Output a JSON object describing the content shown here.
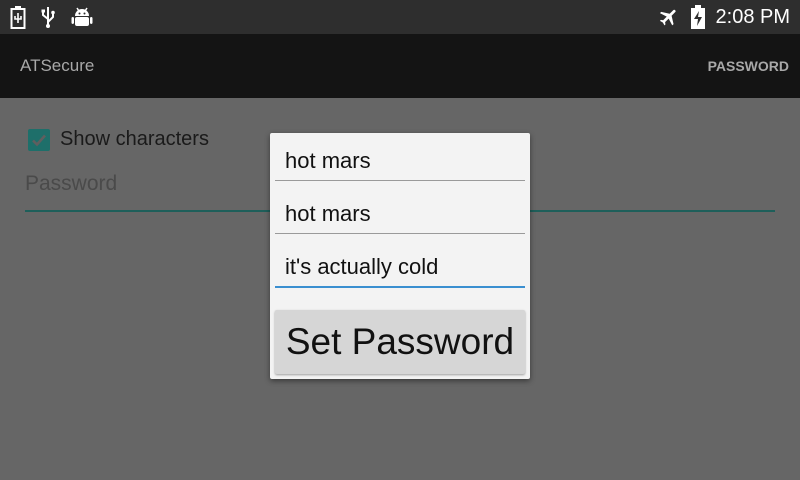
{
  "status_bar": {
    "left_icons": [
      "battery-icon",
      "usb-icon",
      "android-debug-icon"
    ],
    "right_icons": [
      "airplane-mode-icon",
      "battery-charging-icon"
    ],
    "time": "2:08 PM"
  },
  "action_bar": {
    "title": "ATSecure",
    "action": "PASSWORD"
  },
  "content": {
    "show_characters": {
      "label": "Show characters",
      "checked": true
    },
    "password_placeholder": "Password"
  },
  "dialog": {
    "fields": [
      {
        "value": "hot mars",
        "focused": false
      },
      {
        "value": "hot mars",
        "focused": false
      },
      {
        "value": "it's actually cold",
        "focused": true
      }
    ],
    "button": "Set Password"
  },
  "colors": {
    "accent": "#1e6f6a",
    "focus_underline": "#3a8fd0",
    "scrim": "#666666",
    "action_bar": "#141414"
  }
}
